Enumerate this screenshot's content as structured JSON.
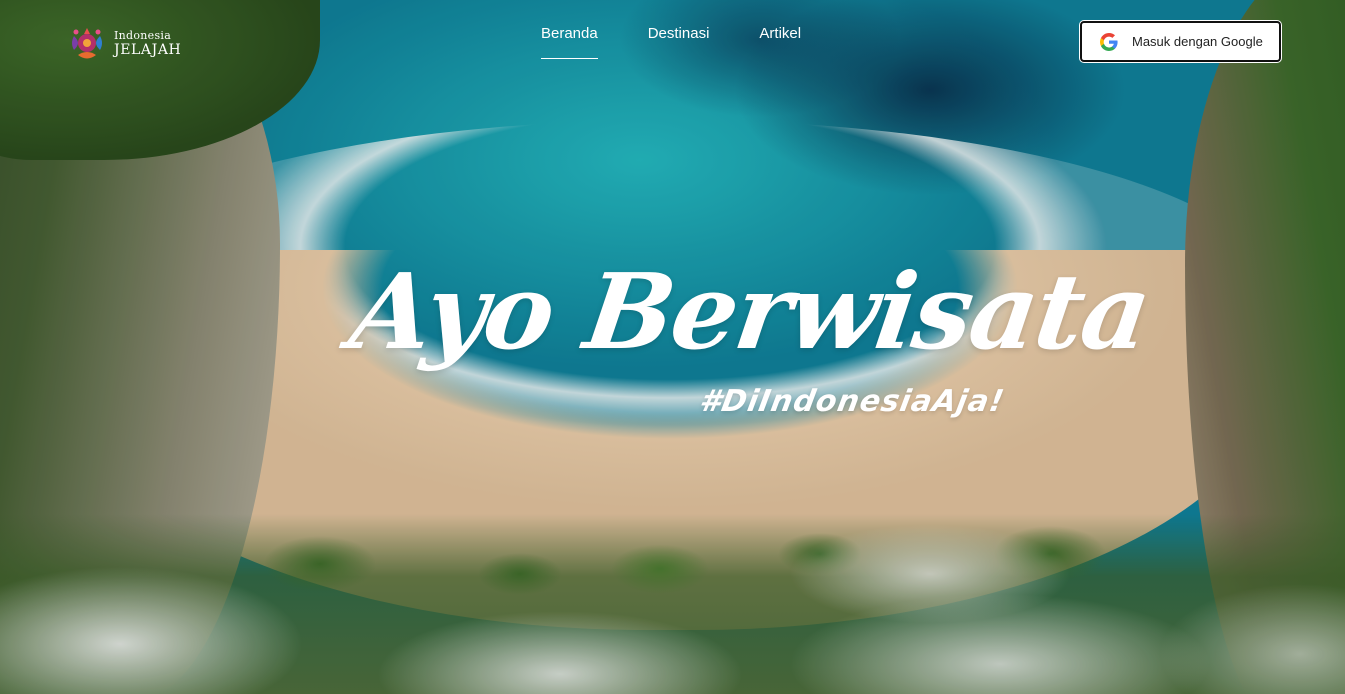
{
  "header": {
    "logo": {
      "line1": "Indonesia",
      "line2": "JELAJAH"
    },
    "nav": [
      {
        "label": "Beranda",
        "active": true
      },
      {
        "label": "Destinasi",
        "active": false
      },
      {
        "label": "Artikel",
        "active": false
      }
    ],
    "login_button": {
      "label": "Masuk dengan Google",
      "icon": "google-icon"
    }
  },
  "hero": {
    "title": "Ayo Berwisata",
    "tagline": "#DiIndonesiaAja!"
  },
  "colors": {
    "sea": "#1aa6b0",
    "sand": "#e6c9a6",
    "text": "#ffffff",
    "button_border": "#111111"
  }
}
